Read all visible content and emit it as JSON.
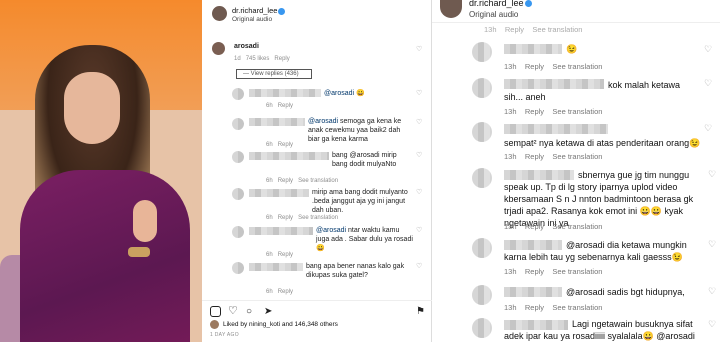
{
  "mid": {
    "header_user": "dr.richard_lee",
    "header_sub": "Original audio",
    "main_comment": {
      "user": "arosadi",
      "time": "1d",
      "likes": "745 likes",
      "reply": "Reply",
      "view_replies": "View replies (436)"
    },
    "replies": [
      {
        "mention": "@arosadi",
        "text": "😀",
        "time": "6h",
        "reply": "Reply",
        "extra": ""
      },
      {
        "mention": "@arosadi",
        "text": "semoga ga kena ke anak cewekmu yaa baik2 dah biar ga kena karma",
        "time": "6h",
        "reply": "Reply",
        "extra": ""
      },
      {
        "mention": "",
        "text": "bang @arosadi mirip bang dodit mulyaNto",
        "time": "6h",
        "reply": "Reply",
        "extra": "See translation"
      },
      {
        "mention": "",
        "text": "mirip ama bang dodit mulyanto .beda janggut aja yg ini jangut dah uban.",
        "time": "6h",
        "reply": "Reply",
        "extra": "See translation"
      },
      {
        "mention": "@arosadi",
        "text": "ntar waktu kamu juga ada . Sabar dulu ya rosadi 😀",
        "time": "6h",
        "reply": "Reply",
        "extra": ""
      },
      {
        "mention": "",
        "text": "bang apa bener nanas kalo gak dikupas suka gatel?",
        "time": "6h",
        "reply": "Reply",
        "extra": ""
      }
    ],
    "likes_text": "Liked by nining_koti and 146,348 others",
    "date": "1 DAY AGO"
  },
  "right": {
    "header_user": "dr.richard_lee",
    "header_sub": "Original audio",
    "see_translation": "See translation",
    "comments": [
      {
        "text": "😉",
        "time": "13h",
        "reply": "Reply",
        "extra": "See translation"
      },
      {
        "text": "kok malah ketawa sih... aneh",
        "time": "13h",
        "reply": "Reply",
        "extra": "See translation"
      },
      {
        "text": "sempat² nya ketawa di atas penderitaan orang😉",
        "time": "13h",
        "reply": "Reply",
        "extra": "See translation"
      },
      {
        "text": "sbnernya gue jg tim nunggu speak up. Tp di lg story iparnya uplod video kbersamaan S n J nnton badmintoon berasa gk trjadi apa2. Rasanya kok emot ini 😀😀 kyak ngetawain ini ya",
        "time": "13h",
        "reply": "Reply",
        "extra": "See translation"
      },
      {
        "text": "@arosadi dia ketawa mungkin karna lebih tau yg sebenarnya kali gaesss😉",
        "time": "13h",
        "reply": "Reply",
        "extra": "See translation"
      },
      {
        "text": "@arosadi sadis bgt hidupnya,",
        "time": "13h",
        "reply": "Reply",
        "extra": "See translation"
      },
      {
        "text": "Lagi ngetawain busuknya sifat adek ipar kau ya rosadiiiii syalalala😀 @arosadi",
        "time": "",
        "reply": "",
        "extra": ""
      }
    ]
  }
}
